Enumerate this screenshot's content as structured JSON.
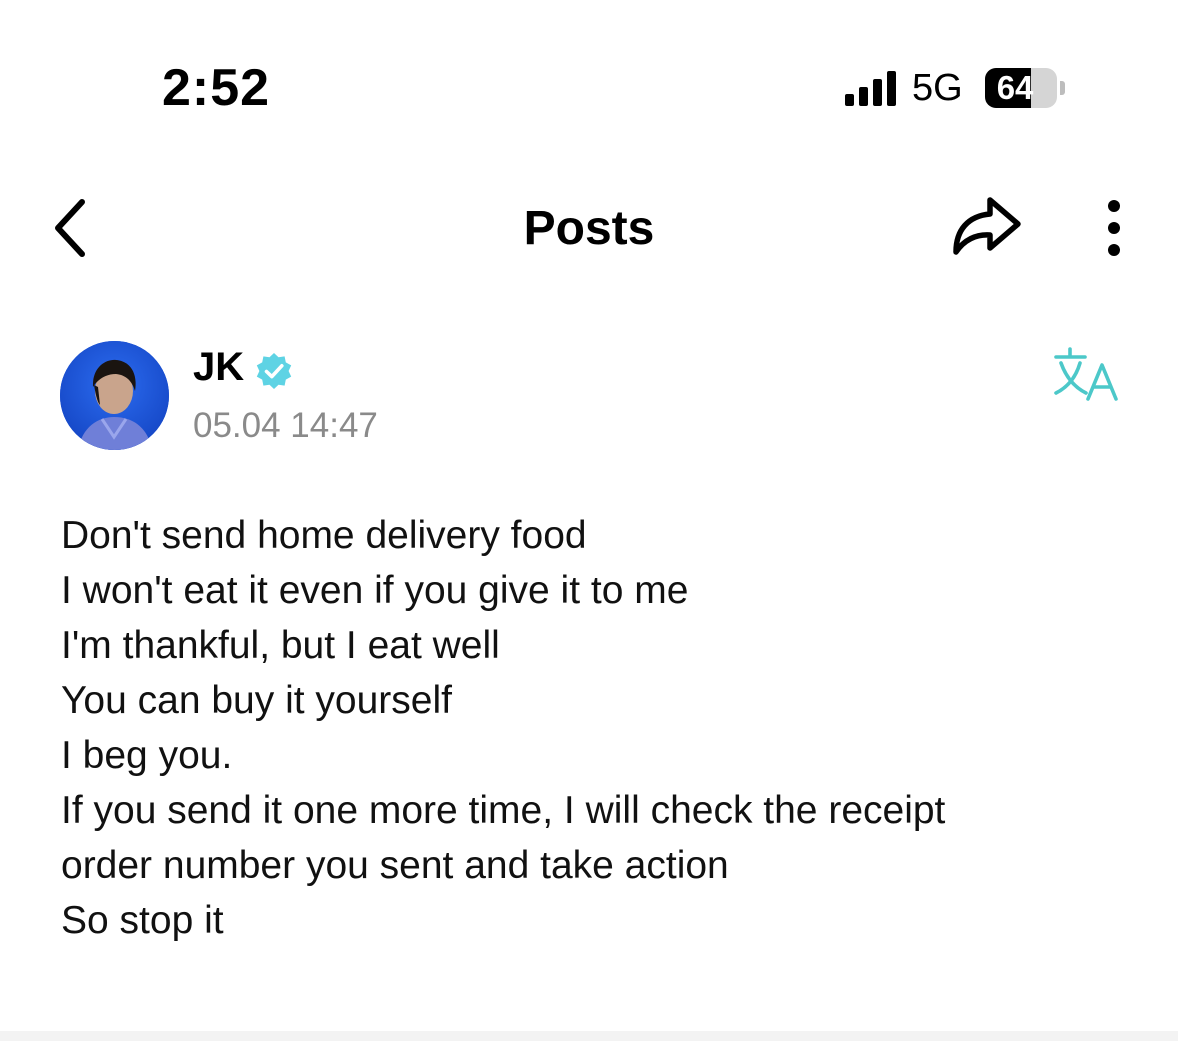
{
  "status_bar": {
    "time": "2:52",
    "network": "5G",
    "battery_percent": "64",
    "battery_level": 0.64,
    "signal_bars": 4
  },
  "nav": {
    "title": "Posts",
    "back_icon": "chevron-left-icon",
    "share_icon": "share-arrow-icon",
    "more_icon": "more-vertical-icon"
  },
  "post": {
    "author": "JK",
    "verified": true,
    "verified_color": "#5ed3e4",
    "timestamp": "05.04 14:47",
    "translate_icon": "translate-icon",
    "translate_color": "#4cc8c9",
    "lines": [
      "Don't send home delivery food",
      "I won't eat it even if you give it to me",
      "I'm thankful, but I eat well",
      "You can buy it yourself",
      "I beg you.",
      "If you send it one more time, I will check the receipt",
      "order number you sent and take action",
      "So stop it"
    ]
  }
}
